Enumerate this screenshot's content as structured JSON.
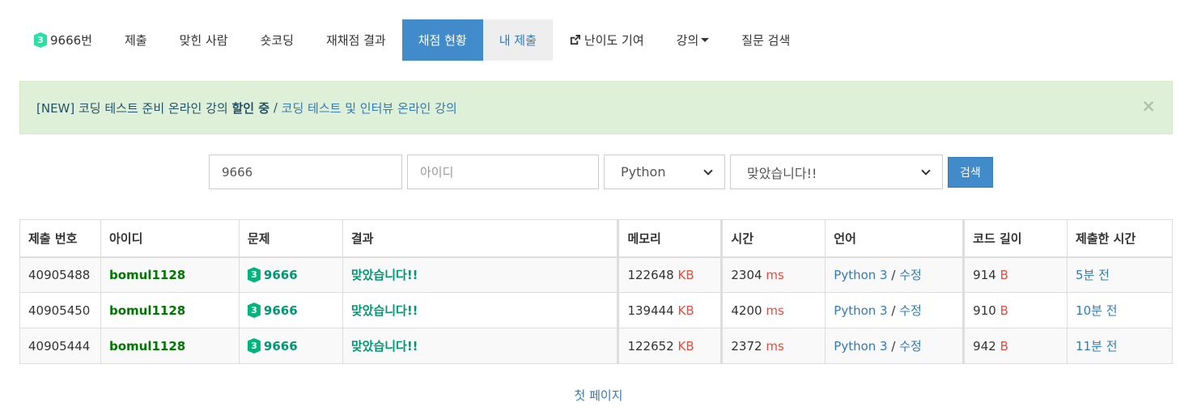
{
  "tabs": {
    "problem": "9666번",
    "problem_tier": "3",
    "submit": "제출",
    "accepted_users": "맞힌 사람",
    "short_coding": "숏코딩",
    "rejudge_results": "재채점 결과",
    "status": "채점 현황",
    "my_submissions": "내 제출",
    "difficulty": "난이도 기여",
    "lecture": "강의",
    "question_search": "질문 검색"
  },
  "alert": {
    "prefix": "[NEW] 코딩 테스트 준비 온라인 강의 ",
    "bold": "할인 중",
    "separator": " / ",
    "link2": "코딩 테스트 및 인터뷰 온라인 강의",
    "close": "×"
  },
  "search": {
    "problem_value": "9666",
    "user_placeholder": "아이디",
    "language": "Python",
    "result": "맞았습니다!!",
    "button": "검색"
  },
  "table": {
    "headers": [
      "제출 번호",
      "아이디",
      "문제",
      "결과",
      "메모리",
      "시간",
      "언어",
      "코드 길이",
      "제출한 시간"
    ],
    "rows": [
      {
        "id": "40905488",
        "user": "bomul1128",
        "tier": "3",
        "problem": "9666",
        "result": "맞았습니다!!",
        "memory": "122648",
        "memory_unit": "KB",
        "time": "2304",
        "time_unit": "ms",
        "language": "Python 3",
        "edit": "수정",
        "length": "914",
        "length_unit": "B",
        "submitted": "5분 전"
      },
      {
        "id": "40905450",
        "user": "bomul1128",
        "tier": "3",
        "problem": "9666",
        "result": "맞았습니다!!",
        "memory": "139444",
        "memory_unit": "KB",
        "time": "4200",
        "time_unit": "ms",
        "language": "Python 3",
        "edit": "수정",
        "length": "910",
        "length_unit": "B",
        "submitted": "10분 전"
      },
      {
        "id": "40905444",
        "user": "bomul1128",
        "tier": "3",
        "problem": "9666",
        "result": "맞았습니다!!",
        "memory": "122652",
        "memory_unit": "KB",
        "time": "2372",
        "time_unit": "ms",
        "language": "Python 3",
        "edit": "수정",
        "length": "942",
        "length_unit": "B",
        "submitted": "11분 전"
      }
    ]
  },
  "pager": {
    "first_page": "첫 페이지"
  },
  "colors": {
    "primary": "#428bca",
    "alert_bg": "#dff0d8",
    "accepted": "#009874",
    "unit": "#e74c3c",
    "tier": "#27e2a4"
  },
  "icons": {
    "tier": "tier-badge-icon",
    "external": "external-link-icon",
    "caret": "caret-down-icon",
    "close": "close-icon",
    "select": "chevron-down-icon"
  }
}
